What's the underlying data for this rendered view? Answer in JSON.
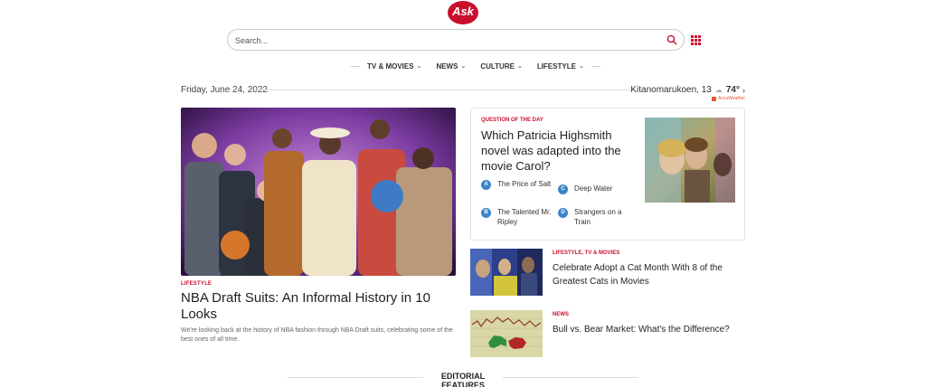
{
  "brand": {
    "logo_text": "Ask",
    "accent": "#c8102e"
  },
  "search": {
    "placeholder": "Search...",
    "value": "",
    "icon": "search-icon"
  },
  "apps_icon": "apps-grid-icon",
  "nav": {
    "items": [
      {
        "label": "TV & MOVIES"
      },
      {
        "label": "NEWS"
      },
      {
        "label": "CULTURE"
      },
      {
        "label": "LIFESTYLE"
      }
    ]
  },
  "date": "Friday, June 24, 2022",
  "weather": {
    "location": "Kitanomarukoen, 13",
    "temp": "74°",
    "provider": "AccuWeather"
  },
  "hero": {
    "category": "LIFESTYLE",
    "title": "NBA Draft Suits: An Informal History in 10 Looks",
    "description": "We're looking back at the history of NBA fashion through NBA Draft suits, celebrating some of the best ones of all time."
  },
  "qotd": {
    "label": "QUESTION OF THE DAY",
    "question": "Which Patricia Highsmith novel was adapted into the movie Carol?",
    "options": [
      {
        "letter": "A",
        "text": "The Price of Salt"
      },
      {
        "letter": "B",
        "text": "The Talented Mr. Ripley"
      },
      {
        "letter": "C",
        "text": "Deep Water"
      },
      {
        "letter": "D",
        "text": "Strangers on a Train"
      }
    ],
    "option_color": "#3b86c6"
  },
  "articles": [
    {
      "category": "LIFESTYLE, TV & MOVIES",
      "title": "Celebrate Adopt a Cat Month With 8 of the Greatest Cats in Movies"
    },
    {
      "category": "NEWS",
      "title": "Bull vs. Bear Market: What's the Difference?"
    }
  ],
  "section_heading": "EDITORIAL FEATURES"
}
